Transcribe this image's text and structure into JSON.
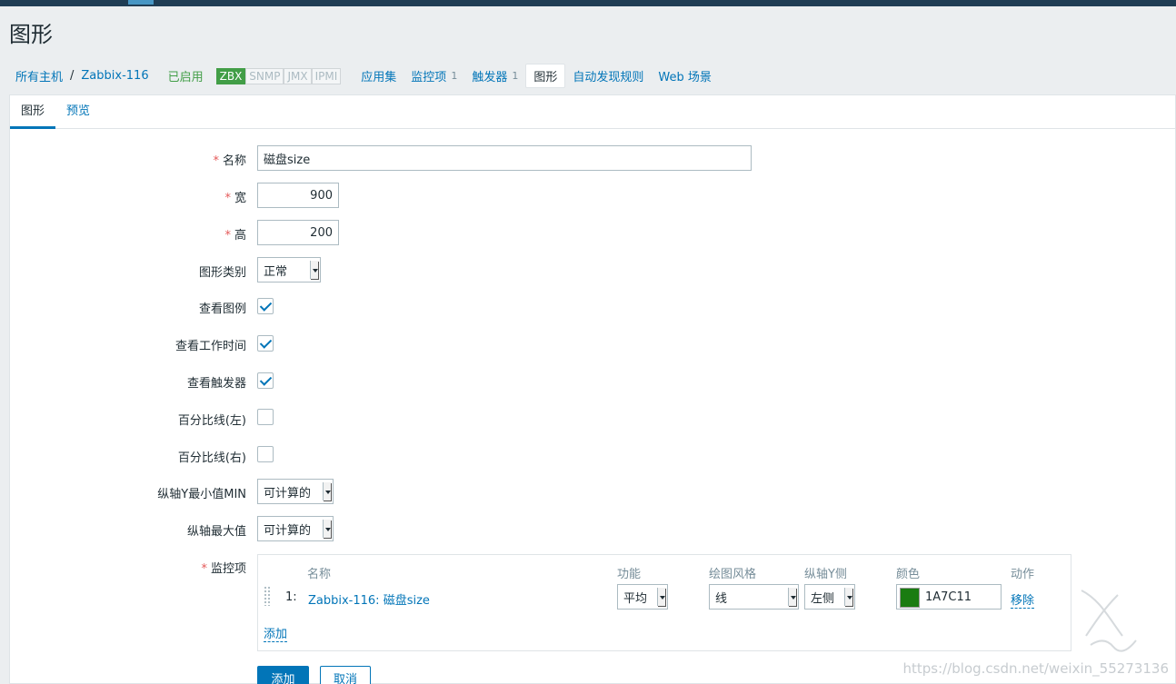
{
  "page": {
    "title": "图形"
  },
  "breadcrumb": {
    "all_hosts": "所有主机",
    "separator": "/",
    "host": "Zabbix-116",
    "status": "已启用",
    "availability": [
      "ZBX",
      "SNMP",
      "JMX",
      "IPMI"
    ]
  },
  "host_nav": [
    {
      "label": "应用集",
      "count": ""
    },
    {
      "label": "监控项",
      "count": "1"
    },
    {
      "label": "触发器",
      "count": "1"
    },
    {
      "label": "图形",
      "count": "",
      "selected": true
    },
    {
      "label": "自动发现规则",
      "count": ""
    },
    {
      "label": "Web 场景",
      "count": ""
    }
  ],
  "tabs": [
    "图形",
    "预览"
  ],
  "form": {
    "required_mark": "*",
    "name_label": "名称",
    "name_value": "磁盘size",
    "width_label": "宽",
    "width_value": "900",
    "height_label": "高",
    "height_value": "200",
    "graph_type_label": "图形类别",
    "graph_type_value": "正常",
    "show_legend_label": "查看图例",
    "show_legend": true,
    "show_work_period_label": "查看工作时间",
    "show_work_period": true,
    "show_triggers_label": "查看触发器",
    "show_triggers": true,
    "percentile_left_label": "百分比线(左)",
    "percentile_left": false,
    "percentile_right_label": "百分比线(右)",
    "percentile_right": false,
    "ymin_label": "纵轴Y最小值MIN",
    "ymin_value": "可计算的",
    "ymax_label": "纵轴最大值",
    "ymax_value": "可计算的",
    "items_label": "监控项"
  },
  "items_table": {
    "headers": [
      "名称",
      "功能",
      "绘图风格",
      "纵轴Y侧",
      "颜色",
      "动作"
    ],
    "rows": [
      {
        "num": "1:",
        "name": "Zabbix-116: 磁盘size",
        "function": "平均",
        "draw_style": "线",
        "y_axis_side": "左侧",
        "color": "1A7C11",
        "action": "移除"
      }
    ],
    "add_link": "添加"
  },
  "buttons": {
    "add": "添加",
    "cancel": "取消"
  },
  "watermark": "https://blog.csdn.net/weixin_55273136",
  "colors": {
    "accent": "#0275b8",
    "enabled": "#429e47",
    "item_color": "#1A7C11"
  }
}
